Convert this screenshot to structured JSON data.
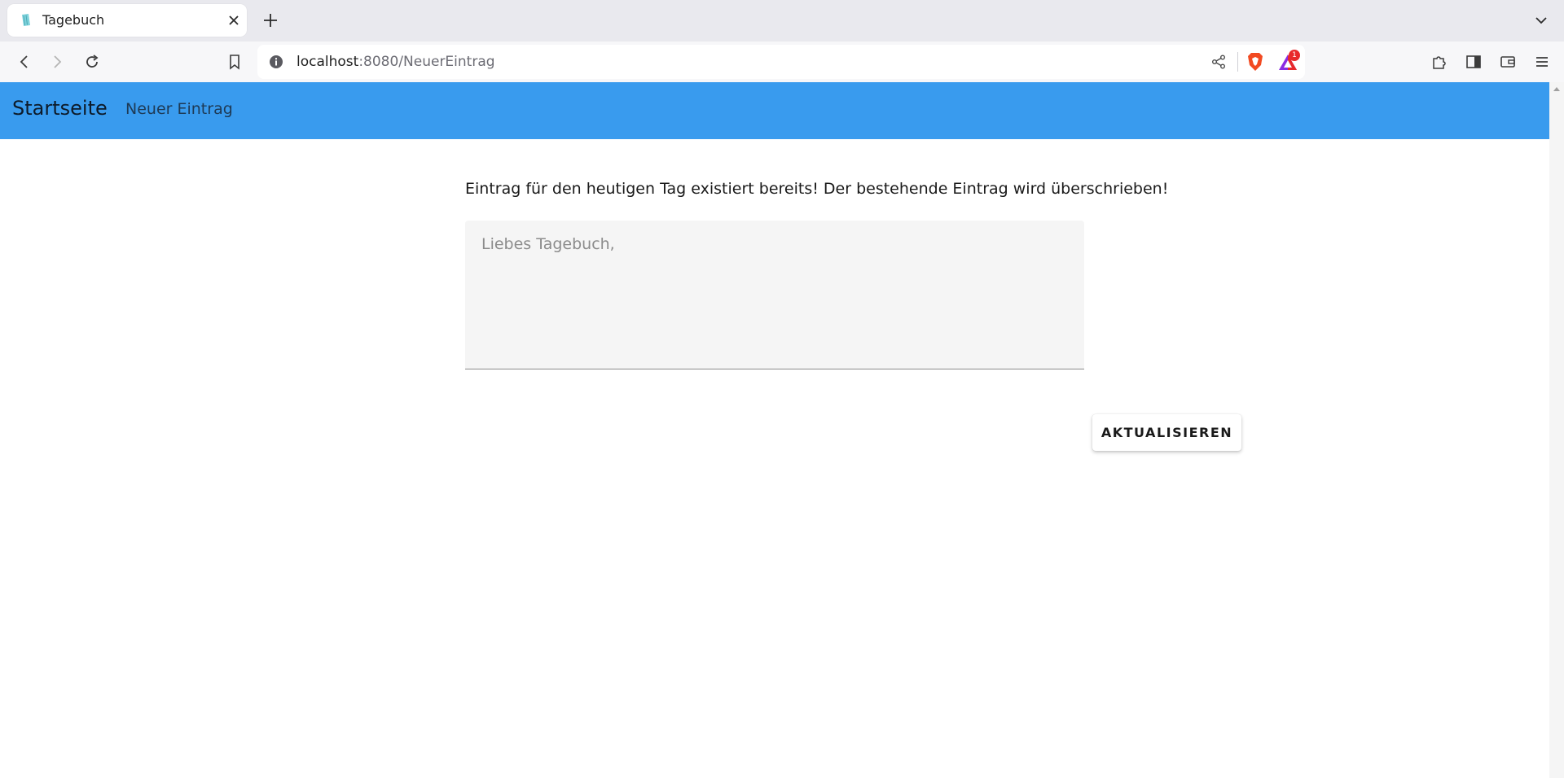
{
  "browser": {
    "tab": {
      "title": "Tagebuch"
    },
    "url": {
      "host": "localhost",
      "rest": ":8080/NeuerEintrag"
    },
    "rewards_badge": "1"
  },
  "nav": {
    "brand": "Startseite",
    "link_new_entry": "Neuer Eintrag"
  },
  "main": {
    "notice": "Eintrag für den heutigen Tag existiert bereits! Der bestehende Eintrag wird überschrieben!",
    "entry_placeholder": "Liebes Tagebuch,",
    "update_button": "AKTUALISIEREN"
  },
  "colors": {
    "navbar": "#399bee",
    "tab_strip": "#e9e9ee",
    "toolbar": "#f7f7f9"
  }
}
